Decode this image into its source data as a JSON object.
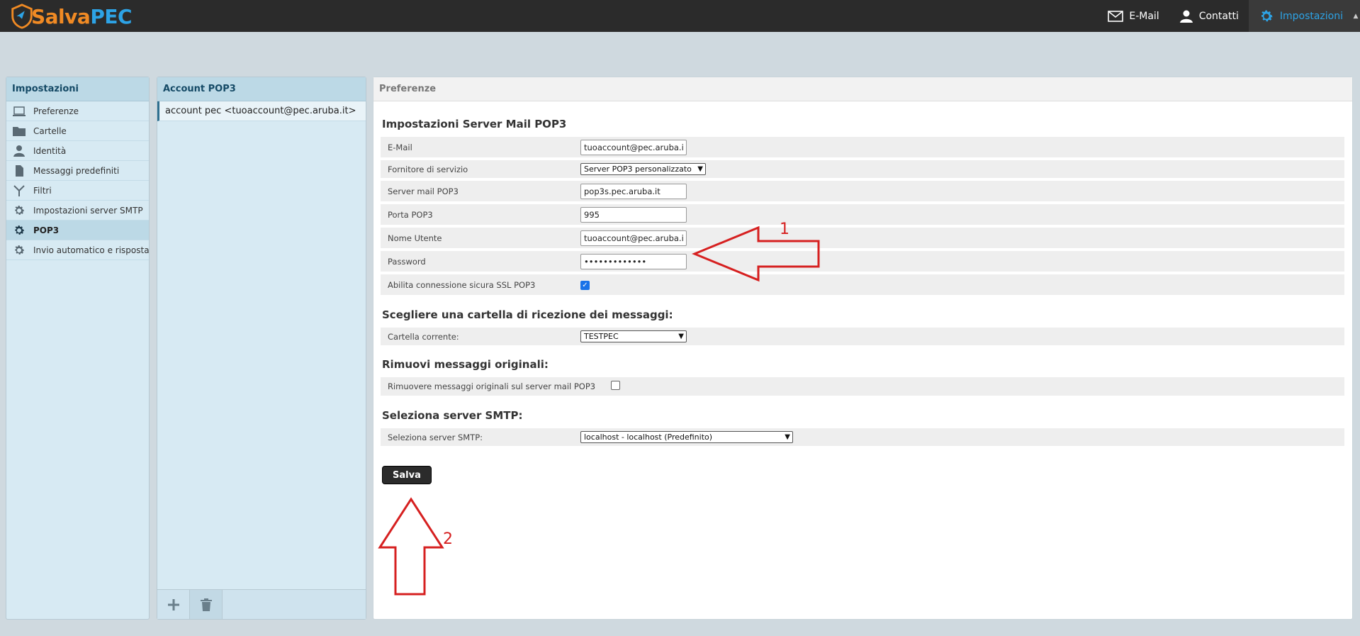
{
  "brand": {
    "part1": "Salva",
    "part2": "PEC"
  },
  "nav": {
    "email": "E-Mail",
    "contacts": "Contatti",
    "settings": "Impostazioni"
  },
  "sidebar": {
    "title": "Impostazioni",
    "items": [
      {
        "label": "Preferenze",
        "icon": "laptop-icon"
      },
      {
        "label": "Cartelle",
        "icon": "folder-icon"
      },
      {
        "label": "Identità",
        "icon": "user-icon"
      },
      {
        "label": "Messaggi predefiniti",
        "icon": "document-icon"
      },
      {
        "label": "Filtri",
        "icon": "filter-icon"
      },
      {
        "label": "Impostazioni server SMTP",
        "icon": "gear-icon"
      },
      {
        "label": "POP3",
        "icon": "gear-icon"
      },
      {
        "label": "Invio automatico e risposta au",
        "icon": "gear-icon"
      }
    ]
  },
  "accounts": {
    "title": "Account POP3",
    "items": [
      "account pec <tuoaccount@pec.aruba.it>"
    ]
  },
  "main": {
    "title": "Preferenze",
    "section1": {
      "title": "Impostazioni Server Mail POP3",
      "email_label": "E-Mail",
      "email_value": "tuoaccount@pec.aruba.it",
      "provider_label": "Fornitore di servizio",
      "provider_value": "Server POP3 personalizzato",
      "server_label": "Server mail POP3",
      "server_value": "pop3s.pec.aruba.it",
      "port_label": "Porta POP3",
      "port_value": "995",
      "user_label": "Nome Utente",
      "user_value": "tuoaccount@pec.aruba.it",
      "password_label": "Password",
      "password_value": "•••••••••••••",
      "ssl_label": "Abilita connessione sicura SSL POP3",
      "ssl_checked": true
    },
    "section2": {
      "title": "Scegliere una cartella di ricezione dei messaggi:",
      "folder_label": "Cartella corrente:",
      "folder_value": "TESTPEC"
    },
    "section3": {
      "title": "Rimuovi messaggi originali:",
      "remove_label": "Rimuovere messaggi originali sul server mail POP3",
      "remove_checked": false
    },
    "section4": {
      "title": "Seleziona server SMTP:",
      "smtp_label": "Seleziona server SMTP:",
      "smtp_value": "localhost - localhost (Predefinito)"
    },
    "save_label": "Salva"
  },
  "annotations": {
    "one": "1",
    "two": "2",
    "color": "#d62020"
  }
}
